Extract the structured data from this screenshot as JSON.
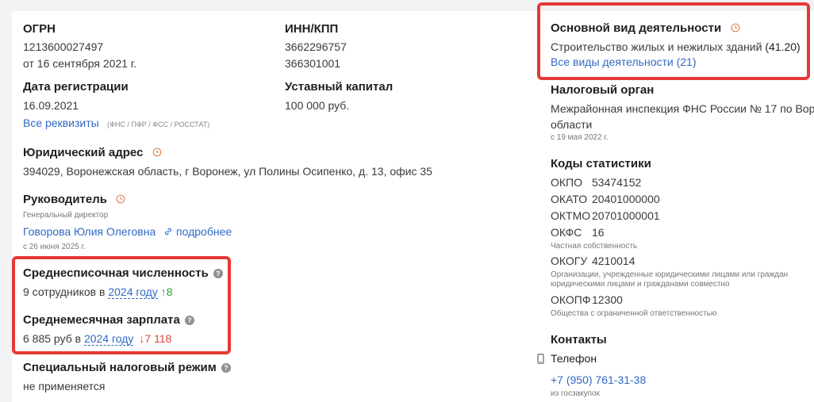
{
  "ogrn": {
    "label": "ОГРН",
    "value": "1213600027497",
    "date": "от 16 сентября 2021 г."
  },
  "innkpp": {
    "label": "ИНН/КПП",
    "inn": "3662296757",
    "kpp": "366301001"
  },
  "reg_date": {
    "label": "Дата регистрации",
    "value": "16.09.2021"
  },
  "capital": {
    "label": "Уставный капитал",
    "value": "100 000 руб."
  },
  "requisites": {
    "link": "Все реквизиты",
    "note": "(ФНС / ПФР / ФСС / РОССТАТ)"
  },
  "address": {
    "label": "Юридический адрес",
    "value": "394029, Воронежская область, г Воронеж, ул Полины Осипенко, д. 13, офис 35"
  },
  "director": {
    "label": "Руководитель",
    "position": "Генеральный директор",
    "name": "Говорова Юлия Олеговна",
    "more": "подробнее",
    "since": "с 26 июня 2025 г."
  },
  "headcount": {
    "label": "Среднесписочная численность",
    "prefix": "9 сотрудников в",
    "year": "2024 году",
    "delta": "↑8"
  },
  "salary": {
    "label": "Среднемесячная зарплата",
    "prefix": "6 885 руб в",
    "year": "2024 году",
    "delta": "↓7 118"
  },
  "tax_regime": {
    "label": "Специальный налоговый режим",
    "value": "не применяется"
  },
  "activity": {
    "label": "Основной вид деятельности",
    "value": "Строительство жилых и нежилых зданий",
    "code": "(41.20)",
    "all_link": "Все виды деятельности (21)"
  },
  "tax_office": {
    "label": "Налоговый орган",
    "line1": "Межрайонная инспекция ФНС России № 17 по Вор",
    "line2": "области",
    "since": "с 19 мая 2022 г."
  },
  "stat_codes": {
    "label": "Коды статистики",
    "okpo": {
      "name": "ОКПО",
      "value": "53474152"
    },
    "okato": {
      "name": "ОКАТО",
      "value": "20401000000"
    },
    "oktmo": {
      "name": "ОКТМО",
      "value": "20701000001"
    },
    "okfs": {
      "name": "ОКФС",
      "value": "16",
      "note": "Частная собственность"
    },
    "okogu": {
      "name": "ОКОГУ",
      "value": "4210014",
      "note1": "Организации, учрежденные юридическими лицами или граждан",
      "note2": "юридическими лицами и гражданами совместно"
    },
    "okopf": {
      "name": "ОКОПФ",
      "value": "12300",
      "note": "Общества с ограниченной ответственностью"
    }
  },
  "contacts": {
    "label": "Контакты",
    "phone_label": "Телефон",
    "phone": "+7 (950) 761-31-38",
    "source": "из госзакупок"
  },
  "colors": {
    "link": "#3168c6",
    "highlight": "#e53935",
    "up": "#2f9b2f",
    "down": "#e0453a"
  }
}
